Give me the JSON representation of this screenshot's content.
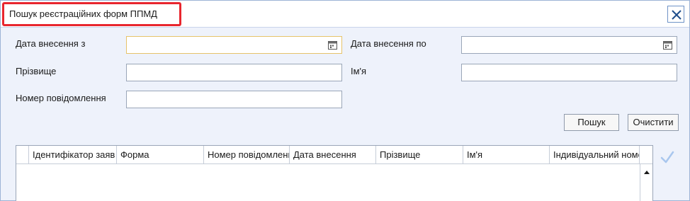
{
  "window": {
    "title": "Пошук реєстраційних форм ППМД",
    "close_label": "×"
  },
  "form": {
    "date_from_label": "Дата внесення з",
    "date_from_value": "",
    "date_to_label": "Дата внесення по",
    "date_to_value": "",
    "surname_label": "Прізвище",
    "surname_value": "",
    "name_label": "Ім'я",
    "name_value": "",
    "message_number_label": "Номер повідомлення",
    "message_number_value": ""
  },
  "buttons": {
    "search": "Пошук",
    "clear": "Очистити"
  },
  "table": {
    "columns": [
      "",
      "Ідентифікатор заяв",
      "Форма",
      "Номер повідомлення",
      "Дата внесення",
      "Прізвище",
      "Ім'я",
      "Індивідуальний номер"
    ],
    "rows": []
  },
  "colors": {
    "title_highlight": "#e8262e",
    "window_background": "#eef2fb",
    "check_icon": "#a9c7ee"
  },
  "icons": {
    "close": "close-icon",
    "calendar": "calendar-icon",
    "check": "check-icon",
    "scroll_up": "scroll-up-arrow-icon"
  }
}
